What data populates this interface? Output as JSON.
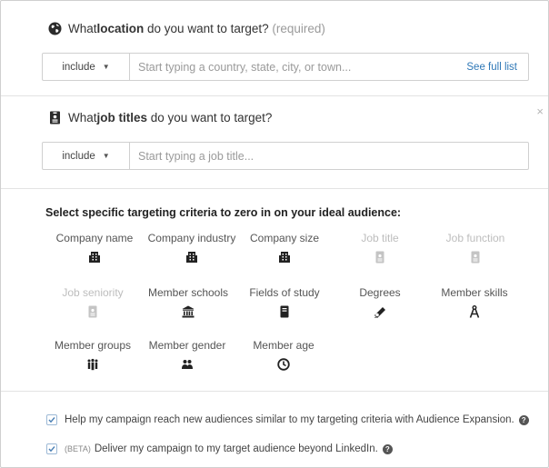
{
  "location": {
    "q_pre": "What ",
    "q_bold": "location",
    "q_post": " do you want to target? ",
    "required": "(required)",
    "include": "include",
    "placeholder": "Start typing a country, state, city, or town...",
    "see_full_list": "See full list",
    "icon": "globe-icon"
  },
  "job_titles": {
    "q_pre": "What ",
    "q_bold": "job titles",
    "q_post": " do you want to target?",
    "include": "include",
    "placeholder": "Start typing a job title...",
    "icon": "id-badge-icon"
  },
  "close_glyph": "×",
  "criteria": {
    "heading": "Select specific targeting criteria to zero in on your ideal audience:",
    "items": [
      {
        "label": "Company name",
        "icon": "building-icon",
        "enabled": true
      },
      {
        "label": "Company industry",
        "icon": "building-icon",
        "enabled": true
      },
      {
        "label": "Company size",
        "icon": "building-icon",
        "enabled": true
      },
      {
        "label": "Job title",
        "icon": "badge-icon",
        "enabled": false
      },
      {
        "label": "Job function",
        "icon": "badge-icon",
        "enabled": false
      },
      {
        "label": "Job seniority",
        "icon": "badge-icon",
        "enabled": false
      },
      {
        "label": "Member schools",
        "icon": "school-icon",
        "enabled": true
      },
      {
        "label": "Fields of study",
        "icon": "book-icon",
        "enabled": true
      },
      {
        "label": "Degrees",
        "icon": "diploma-icon",
        "enabled": true
      },
      {
        "label": "Member skills",
        "icon": "skills-icon",
        "enabled": true
      },
      {
        "label": "Member groups",
        "icon": "group-icon",
        "enabled": true
      },
      {
        "label": "Member gender",
        "icon": "gender-icon",
        "enabled": true
      },
      {
        "label": "Member age",
        "icon": "clock-icon",
        "enabled": true
      }
    ]
  },
  "options": {
    "expansion": "Help my campaign reach new audiences similar to my targeting criteria with Audience Expansion.",
    "beta_tag": "(BETA)",
    "beyond": "Deliver my campaign to my target audience beyond LinkedIn.",
    "help": "?"
  },
  "colors": {
    "link": "#2f78b7",
    "checkbox_border": "#9db9d6",
    "icon_dark": "#222222",
    "icon_disabled": "#c4c4c4"
  }
}
